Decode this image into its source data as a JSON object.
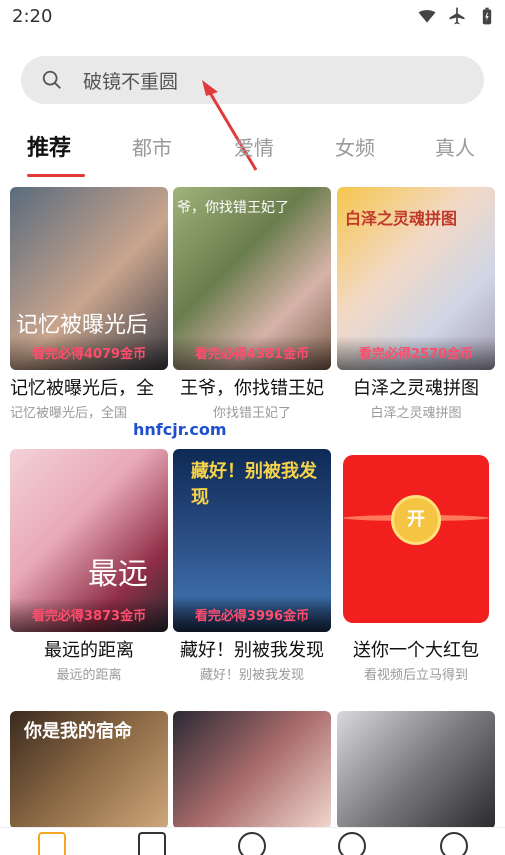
{
  "status_bar": {
    "time": "2:20",
    "icons": [
      "wifi-icon",
      "airplane-icon",
      "battery-icon"
    ]
  },
  "search": {
    "placeholder": "破镜不重圆",
    "icon": "search-icon"
  },
  "tabs": [
    {
      "label": "推荐",
      "active": true
    },
    {
      "label": "都市",
      "active": false
    },
    {
      "label": "爱情",
      "active": false
    },
    {
      "label": "女频",
      "active": false
    },
    {
      "label": "真人",
      "active": false
    }
  ],
  "cards": [
    {
      "title": "记忆被曝光后，全",
      "sub": "记忆被曝光后，全国",
      "reward": "看完必得4079金币",
      "poster_text": "记忆被曝光后"
    },
    {
      "title": "王爷，你找错王妃",
      "sub": "你找错王妃了",
      "reward": "看完必得4381金币",
      "poster_text": "爷，你找错王妃了"
    },
    {
      "title": "白泽之灵魂拼图",
      "sub": "白泽之灵魂拼图",
      "reward": "看完必得2570金币",
      "poster_text": "白泽之灵魂拼图"
    },
    {
      "title": "最远的距离",
      "sub": "最远的距离",
      "reward": "看完必得3873金币",
      "poster_text": "最远"
    },
    {
      "title": "藏好！别被我发现",
      "sub": "藏好！别被我发现",
      "reward": "看完必得3996金币",
      "poster_text": "藏好！别被我发现"
    },
    {
      "title": "送你一个大红包",
      "sub": "看视频后立马得到",
      "reward": "",
      "poster_text": "开"
    },
    {
      "title": "",
      "sub": "",
      "reward": "",
      "poster_text": "你是我的宿命"
    },
    {
      "title": "",
      "sub": "",
      "reward": "",
      "poster_text": ""
    },
    {
      "title": "",
      "sub": "",
      "reward": "",
      "poster_text": ""
    }
  ],
  "watermark": "hnfcjr.com",
  "bottom_nav": [
    "play-icon",
    "video-icon",
    "yuan-icon",
    "yuan-icon",
    "profile-icon"
  ],
  "colors": {
    "accent": "#e03a3a",
    "reward_text": "#ff4d6d",
    "search_bg": "#e9e9e9"
  }
}
